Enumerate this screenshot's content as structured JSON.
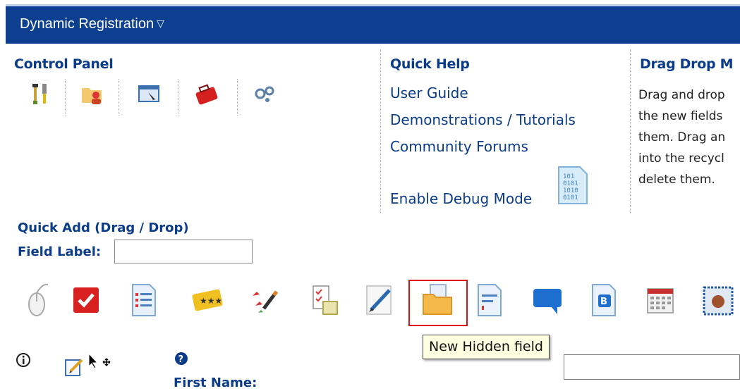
{
  "module": {
    "title": "Dynamic Registration",
    "caret": "▽"
  },
  "control_panel": {
    "title": "Control Panel",
    "icons": [
      "tools-icon",
      "folder-user-icon",
      "window-edit-icon",
      "toolbox-icon",
      "gears-icon"
    ]
  },
  "quick_help": {
    "title": "Quick Help",
    "links": [
      "User Guide",
      "Demonstrations / Tutorials",
      "Community Forums",
      "Enable Debug Mode"
    ]
  },
  "drag_drop": {
    "title": "Drag Drop M",
    "lines": [
      "Drag and drop",
      "the new fields",
      "them. Drag an",
      "into the recycl",
      "delete them."
    ]
  },
  "quick_add": {
    "title": "Quick Add (Drag / Drop)",
    "field_label": "Field Label:",
    "field_value": "",
    "tools": [
      "mouse-icon",
      "checkbox-icon",
      "numbered-list-icon",
      "rating-stars-icon",
      "checklist-pen-icon",
      "checklist-doc-icon",
      "pen-icon",
      "hidden-field-folder-icon",
      "text-doc-icon",
      "speech-bubble-icon",
      "bold-doc-icon",
      "calendar-icon",
      "image-icon"
    ]
  },
  "tooltip": "New Hidden field",
  "form_row": {
    "info_icon": "info-icon",
    "edit_icon": "edit-icon",
    "help_icon": "question-icon",
    "label": "First Name:",
    "value": ""
  },
  "colors": {
    "header": "#0c3f8f",
    "label": "#0b3c8a",
    "highlight": "#e01010",
    "tooltip_bg": "#ffffe1"
  }
}
